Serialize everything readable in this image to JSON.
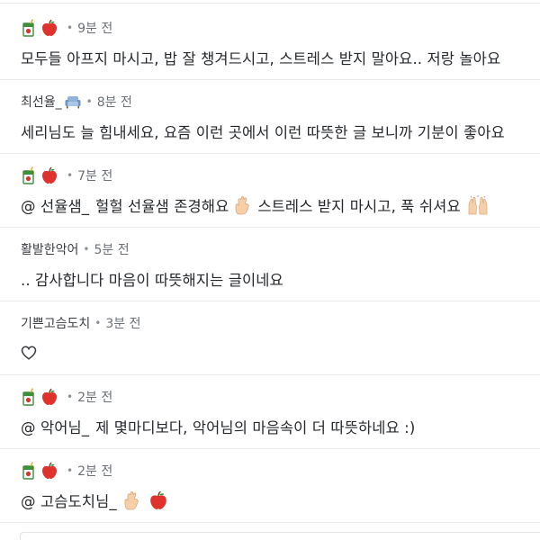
{
  "comments": [
    {
      "author": "",
      "badges": [
        "juice-box-icon",
        "apple-icon"
      ],
      "separator": "•",
      "time": "9분 전",
      "mention": "",
      "text": "모두들 아프지 마시고, 밥 잘 챙겨드시고, 스트레스 받지 말아요.. 저랑 놀아요"
    },
    {
      "author": "최선율_",
      "badges": [
        "sofa-icon"
      ],
      "separator": "•",
      "time": "8분 전",
      "mention": "",
      "text": "세리님도 늘 힘내세요, 요즘 이런 곳에서 이런 따뜻한 글 보니까 기분이 좋아요"
    },
    {
      "author": "",
      "badges": [
        "juice-box-icon",
        "apple-icon"
      ],
      "separator": "•",
      "time": "7분 전",
      "mention": "@ 선율샘_",
      "text_parts": [
        "헐헐 선율샘 존경해요",
        "스트레스 받지 마시고, 푹 쉬셔요"
      ],
      "icons_inline": [
        "crossed-fingers-icon",
        "raised-hands-icon"
      ]
    },
    {
      "author": "활발한악어",
      "badges": [],
      "separator": "•",
      "time": "5분 전",
      "mention": "",
      "text": ".. 감사합니다 마음이 따뜻해지는 글이네요"
    },
    {
      "author": "기쁜고슴도치",
      "badges": [],
      "separator": "•",
      "time": "3분 전",
      "mention": "",
      "text": "",
      "icons_inline": [
        "heart-outline-icon"
      ]
    },
    {
      "author": "",
      "badges": [
        "juice-box-icon",
        "apple-icon"
      ],
      "separator": "•",
      "time": "2분 전",
      "mention": "@ 악어님_",
      "text": "제 몇마디보다, 악어님의 마음속이 더 따뜻하네요 :)"
    },
    {
      "author": "",
      "badges": [
        "juice-box-icon",
        "apple-icon"
      ],
      "separator": "•",
      "time": "2분 전",
      "mention": "@ 고슴도치님_",
      "text": "",
      "icons_inline": [
        "crossed-fingers-icon",
        "apple-icon"
      ]
    }
  ],
  "colors": {
    "text": "#25282c",
    "meta": "#555a60",
    "divider": "#e9ebee",
    "apple": "#e0322c",
    "juice_box": "#3f8f3a"
  }
}
